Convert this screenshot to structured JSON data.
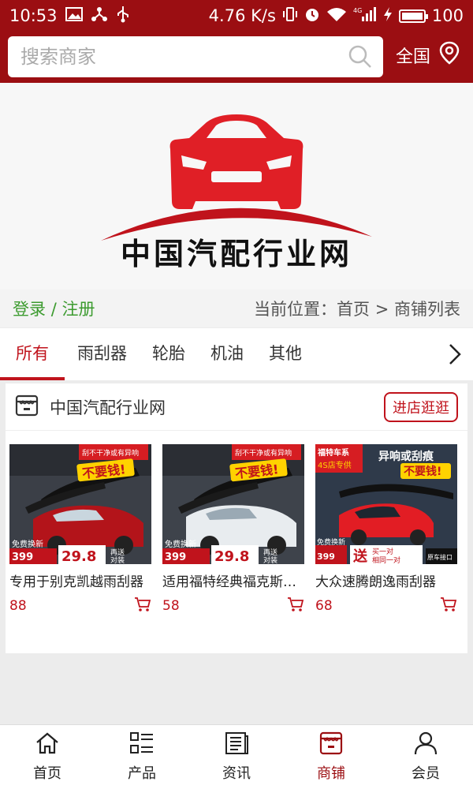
{
  "status_bar": {
    "time": "10:53",
    "speed": "4.76 K/s",
    "network": "4G",
    "battery": "100"
  },
  "header": {
    "search_placeholder": "搜索商家",
    "region": "全国",
    "icons": {
      "search": "search-icon",
      "location": "location-pin-icon"
    }
  },
  "banner": {
    "site_name": "中国汽配行业网",
    "logo_color": "#e01f26"
  },
  "account": {
    "login": "登录",
    "separator": "/",
    "register": "注册"
  },
  "breadcrumb": {
    "label": "当前位置：",
    "home": "首页",
    "arrow": ">",
    "current": "商铺列表"
  },
  "tabs": [
    {
      "label": "所有",
      "active": true
    },
    {
      "label": "雨刮器",
      "active": false
    },
    {
      "label": "轮胎",
      "active": false
    },
    {
      "label": "机油",
      "active": false
    },
    {
      "label": "其他",
      "active": false
    }
  ],
  "shop": {
    "name": "中国汽配行业网",
    "enter_label": "进店逛逛",
    "products": [
      {
        "title": "专用于别克凯越雨刮器",
        "price": "88",
        "promo": [
          "刮不干净或有异响",
          "不要钱!",
          "免费换新",
          "399",
          "29.8",
          "再送",
          "对装"
        ]
      },
      {
        "title": "适用福特经典福克斯雨刮",
        "price": "58",
        "promo": [
          "刮不干净或有异响",
          "不要钱!",
          "免费换新",
          "399",
          "29.8",
          "再送",
          "对装"
        ]
      },
      {
        "title": "大众速腾朗逸雨刮器",
        "price": "68",
        "promo": [
          "福特车系",
          "4S店专供",
          "异响或刮痕",
          "不要钱!",
          "399",
          "免费换新",
          "送",
          "买一对",
          "相同一对",
          "原车接口"
        ]
      }
    ]
  },
  "bottom_nav": [
    {
      "label": "首页",
      "icon": "home-icon",
      "active": false
    },
    {
      "label": "产品",
      "icon": "list-icon",
      "active": false
    },
    {
      "label": "资讯",
      "icon": "news-icon",
      "active": false
    },
    {
      "label": "商铺",
      "icon": "store-icon",
      "active": true
    },
    {
      "label": "会员",
      "icon": "user-icon",
      "active": false
    }
  ],
  "colors": {
    "brand": "#9b0e12",
    "accent": "#c0131c",
    "login_green": "#3c9b2f"
  }
}
